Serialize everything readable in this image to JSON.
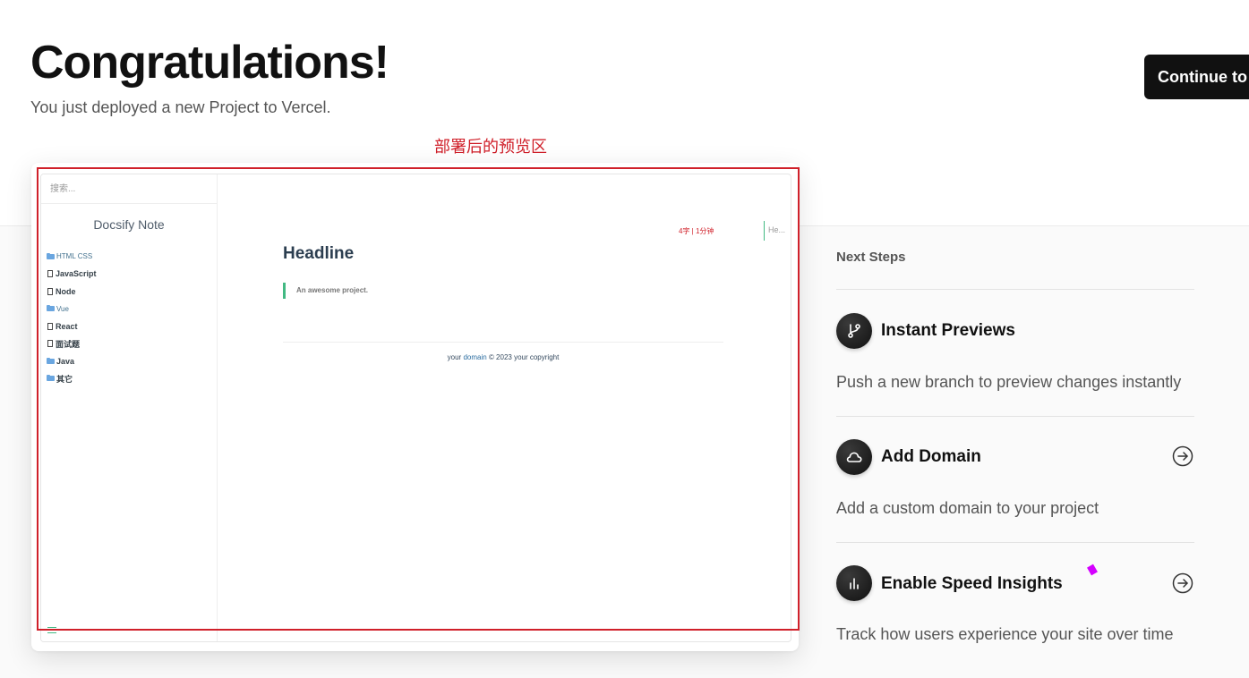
{
  "header": {
    "title": "Congratulations!",
    "subtitle": "You just deployed a new Project to Vercel.",
    "continue_label": "Continue to"
  },
  "annotation": {
    "label": "部署后的预览区"
  },
  "preview": {
    "search_placeholder": "搜索...",
    "site_name": "Docsify Note",
    "nav": [
      {
        "label": "HTML CSS",
        "icon": "folder-icon"
      },
      {
        "label": "JavaScript",
        "icon": "file-icon"
      },
      {
        "label": "Node",
        "icon": "file-icon"
      },
      {
        "label": "Vue",
        "icon": "folder-icon"
      },
      {
        "label": "React",
        "icon": "file-icon"
      },
      {
        "label": "面试题",
        "icon": "file-icon"
      },
      {
        "label": "Java",
        "icon": "folder-icon"
      },
      {
        "label": "其它",
        "icon": "folder-icon"
      }
    ],
    "stats": "4字 | 1分钟",
    "toc_text": "He...",
    "headline": "Headline",
    "quote": "An awesome project.",
    "footer_prefix": "your",
    "footer_link": "domain",
    "footer_suffix": "© 2023 your copyright"
  },
  "next_steps": {
    "title": "Next Steps",
    "items": [
      {
        "title": "Instant Previews",
        "description": "Push a new branch to preview changes instantly",
        "icon": "git-branch-icon",
        "has_arrow": false
      },
      {
        "title": "Add Domain",
        "description": "Add a custom domain to your project",
        "icon": "cloud-icon",
        "has_arrow": true
      },
      {
        "title": "Enable Speed Insights",
        "description": "Track how users experience your site over time",
        "icon": "bar-chart-icon",
        "has_arrow": true
      }
    ]
  },
  "colors": {
    "annotation": "#d0202a",
    "docsify_accent": "#42b983",
    "button_bg": "#111111"
  }
}
